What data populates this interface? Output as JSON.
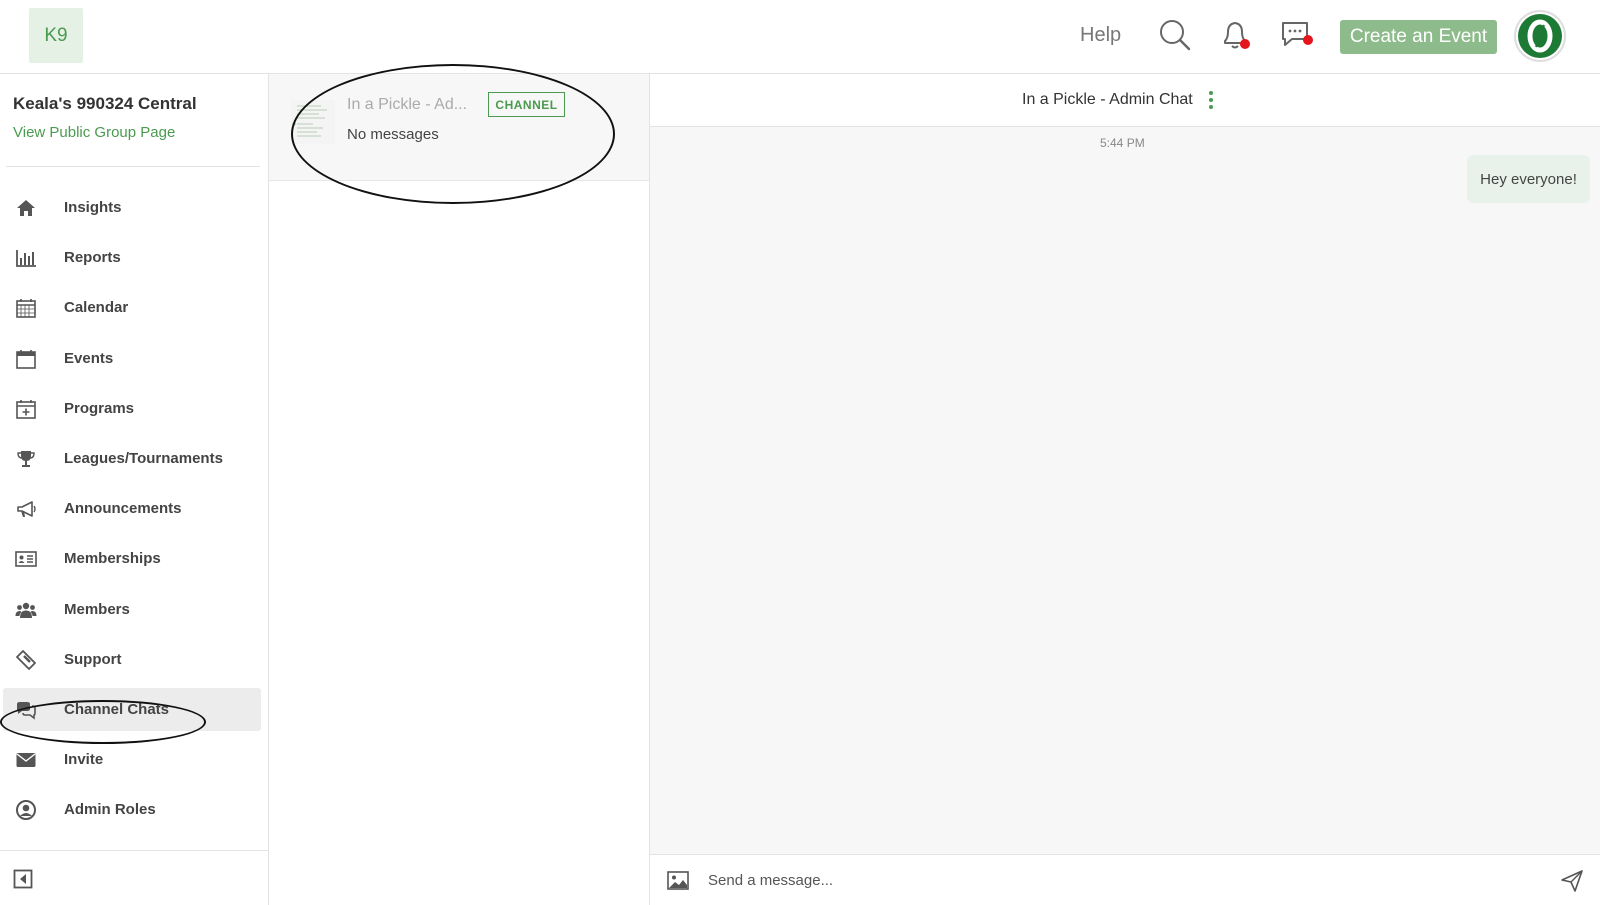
{
  "header": {
    "logo_text": "K9",
    "help_label": "Help",
    "create_event_label": "Create an Event",
    "avatar_letter": "O",
    "accent_color": "#8dbb8b",
    "notification_dot_color": "#e4161c"
  },
  "sidebar": {
    "group_name": "Keala's 990324 Central",
    "public_link": "View Public Group Page",
    "items": [
      {
        "label": "Insights",
        "icon": "home-icon"
      },
      {
        "label": "Reports",
        "icon": "bar-chart-icon"
      },
      {
        "label": "Calendar",
        "icon": "calendar-grid-icon"
      },
      {
        "label": "Events",
        "icon": "calendar-icon"
      },
      {
        "label": "Programs",
        "icon": "calendar-plus-icon"
      },
      {
        "label": "Leagues/Tournaments",
        "icon": "trophy-icon"
      },
      {
        "label": "Announcements",
        "icon": "megaphone-icon"
      },
      {
        "label": "Memberships",
        "icon": "id-card-icon"
      },
      {
        "label": "Members",
        "icon": "users-icon"
      },
      {
        "label": "Support",
        "icon": "ticket-icon"
      },
      {
        "label": "Channel Chats",
        "icon": "chat-bubbles-icon",
        "active": true
      },
      {
        "label": "Invite",
        "icon": "envelope-icon"
      },
      {
        "label": "Admin Roles",
        "icon": "user-circle-icon"
      }
    ]
  },
  "channel_list": {
    "items": [
      {
        "name": "In a Pickle - Ad...",
        "badge": "CHANNEL",
        "preview": "No messages"
      }
    ]
  },
  "chat": {
    "title": "In a Pickle - Admin Chat",
    "time": "5:44 PM",
    "messages": [
      {
        "text": "Hey everyone!"
      }
    ],
    "composer_placeholder": "Send a message..."
  }
}
